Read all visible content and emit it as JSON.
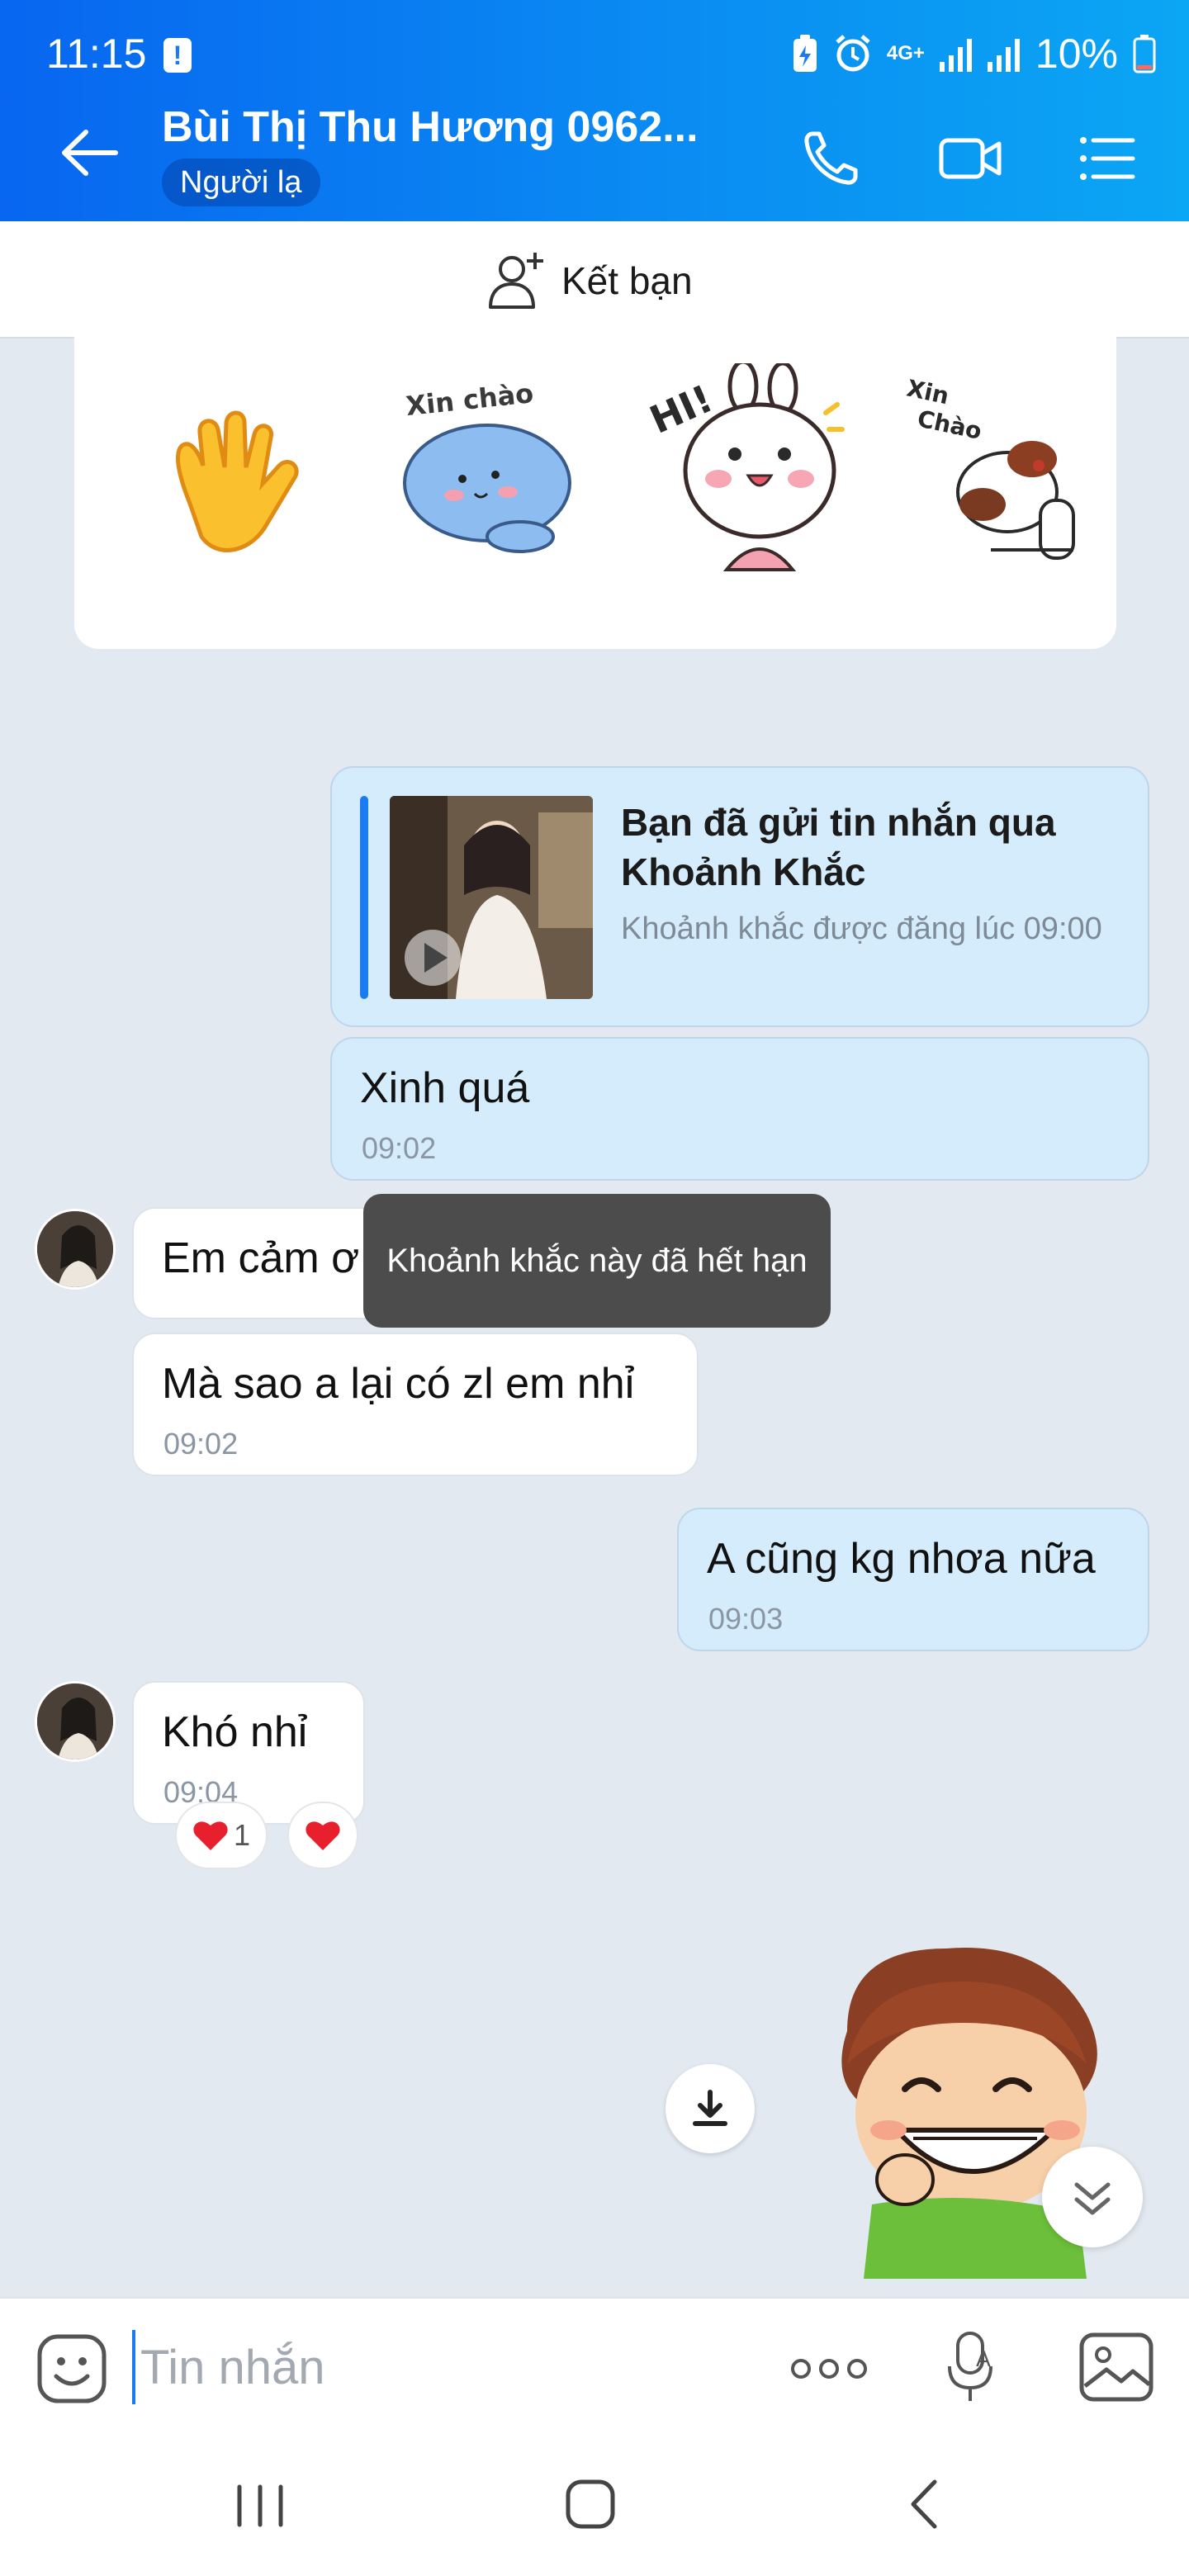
{
  "status_bar": {
    "time": "11:15",
    "network": "4G+",
    "battery": "10%"
  },
  "header": {
    "contact_name": "Bùi Thị Thu Hương 0962...",
    "contact_badge": "Người lạ"
  },
  "add_friend": {
    "label": "Kết bạn"
  },
  "stickers": [
    {
      "name": "waving-hand-sticker"
    },
    {
      "name": "xin-chao-cat-sticker",
      "text": "Xin chào"
    },
    {
      "name": "hi-bunny-sticker",
      "text": "HI!"
    },
    {
      "name": "xin-chao-dog-sticker",
      "text": "Xin Chào"
    }
  ],
  "messages": [
    {
      "sender": "me",
      "type": "moment",
      "title": "Bạn đã gửi tin nhắn qua Khoảnh Khắc",
      "subtitle": "Khoảnh khắc được đăng lúc 09:00"
    },
    {
      "sender": "me",
      "text": "Xinh quá",
      "time": "09:02"
    },
    {
      "sender": "them",
      "text": "Em cảm ơ"
    },
    {
      "sender": "them",
      "text": "Mà sao a lại có zl em nhỉ",
      "time": "09:02"
    },
    {
      "sender": "me",
      "text": "A cũng kg nhơa nữa",
      "time": "09:03"
    },
    {
      "sender": "them",
      "text": "Khó nhỉ",
      "time": "09:04"
    }
  ],
  "reactions": {
    "count": "1"
  },
  "toast": {
    "text": "Khoảnh khắc này đã hết hạn"
  },
  "composer": {
    "placeholder": "Tin nhắn"
  },
  "colors": {
    "accent": "#1a7cf0",
    "header_start": "#0866f0",
    "header_end": "#0ba6f4",
    "my_bubble": "#d5ecfc",
    "chat_background": "#e2e9f1"
  }
}
